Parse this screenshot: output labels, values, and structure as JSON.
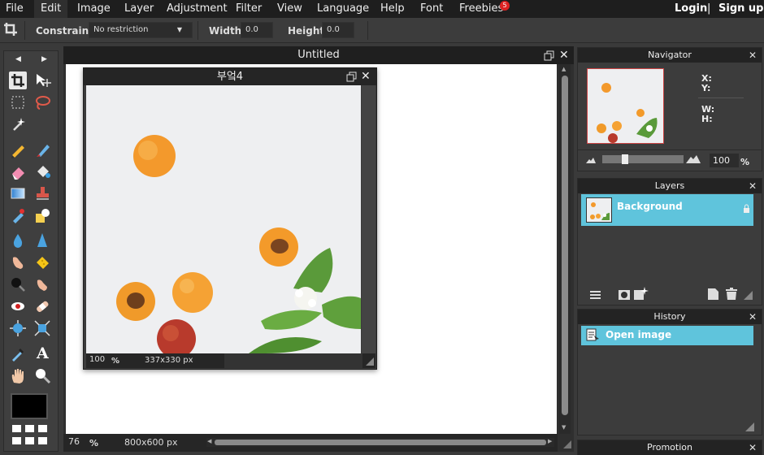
{
  "menu": {
    "items": [
      "File",
      "Edit",
      "Image",
      "Layer",
      "Adjustment",
      "Filter",
      "View",
      "Language",
      "Help",
      "Font",
      "Freebies"
    ],
    "freebies_badge": "5",
    "login": "Login",
    "separator": "|",
    "signup": "Sign up"
  },
  "options": {
    "constraint_label": "Constraint:",
    "constraint_value": "No restriction",
    "width_label": "Width:",
    "width_value": "0.0",
    "height_label": "Height:",
    "height_value": "0.0"
  },
  "canvas_window": {
    "title": "Untitled",
    "zoom": "76",
    "zoom_unit": "%",
    "dimensions": "800x600 px"
  },
  "doc_window": {
    "title": "부엌4",
    "zoom": "100",
    "zoom_unit": "%",
    "dimensions": "337x330 px"
  },
  "navigator": {
    "title": "Navigator",
    "x_label": "X:",
    "y_label": "Y:",
    "w_label": "W:",
    "h_label": "H:",
    "zoom_value": "100",
    "zoom_unit": "%"
  },
  "layers": {
    "title": "Layers",
    "items": [
      {
        "name": "Background"
      }
    ]
  },
  "history": {
    "title": "History",
    "items": [
      {
        "name": "Open image"
      }
    ]
  },
  "promotion": {
    "title": "Promotion"
  },
  "colors": {
    "accent": "#5fc4dc",
    "foreground": "#000000",
    "badge": "#dd2222"
  }
}
